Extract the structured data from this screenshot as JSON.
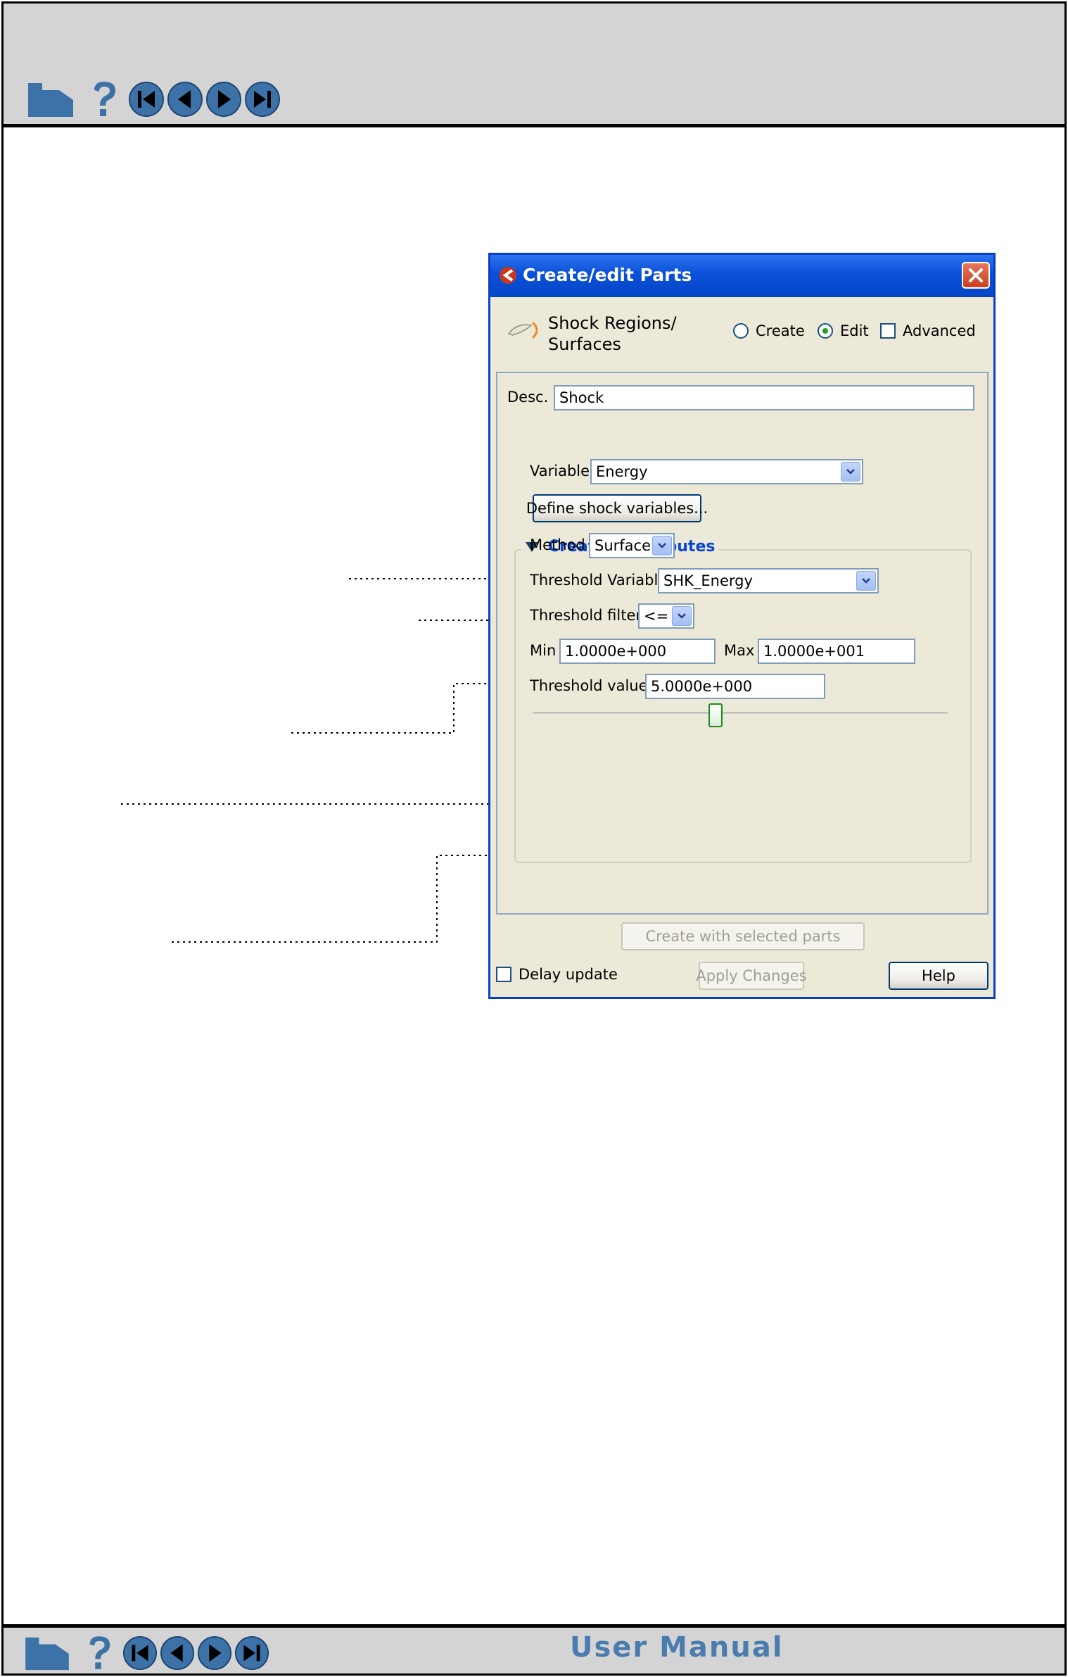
{
  "footer": {
    "title": "User Manual"
  },
  "nav": {
    "home_icon": "home-icon",
    "help_icon": "question-icon",
    "buttons": [
      "first-page-icon",
      "previous-page-icon",
      "next-page-icon",
      "last-page-icon"
    ]
  },
  "dialog": {
    "title": "Create/edit Parts",
    "part_type": "Shock Regions/ Surfaces",
    "mode_create": "Create",
    "mode_edit": "Edit",
    "mode_selected": "Edit",
    "advanced": "Advanced",
    "desc_label": "Desc.",
    "desc_value": "Shock",
    "group_title": "Creation attributes",
    "variable_label": "Variable",
    "variable_value": "Energy",
    "define_button": "Define shock variables...",
    "method_label": "Method",
    "method_value": "Surface",
    "threshold_variable_label": "Threshold Variable",
    "threshold_variable_value": "SHK_Energy",
    "threshold_filter_label": "Threshold filter",
    "threshold_filter_value": "<=",
    "min_label": "Min",
    "min_value": "1.0000e+000",
    "max_label": "Max",
    "max_value": "1.0000e+001",
    "threshold_value_label": "Threshold value",
    "threshold_value": "5.0000e+000",
    "slider_fraction": 0.44,
    "create_button": "Create with selected parts",
    "delay_update": "Delay update",
    "apply_button": "Apply Changes",
    "help_button": "Help"
  },
  "colors": {
    "titlebar": "#0a50d8",
    "accent_text": "#0a46d5",
    "footer_title": "#4a7cae"
  }
}
